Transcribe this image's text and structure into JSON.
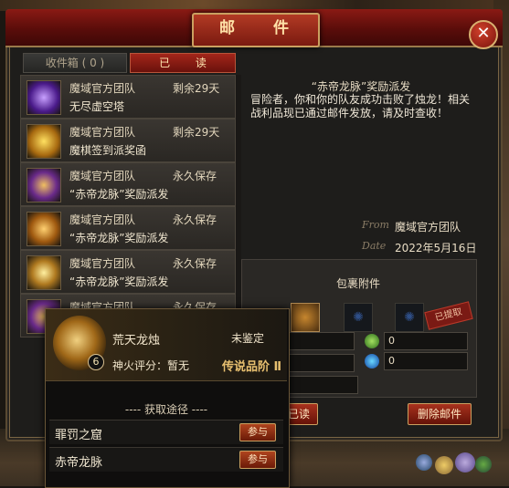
{
  "window": {
    "title": "邮 件",
    "close_label": "✕"
  },
  "tabs": [
    {
      "label": "收件箱 ( 0 )"
    },
    {
      "label": "已 读"
    }
  ],
  "mails": [
    {
      "sender": "魔域官方团队",
      "expiry": "剩余29天",
      "subject": "无尽虚空塔",
      "icon": "void-crystal-icon"
    },
    {
      "sender": "魔域官方团队",
      "expiry": "剩余29天",
      "subject": "魔棋签到派奖函",
      "icon": "gold-chest-icon"
    },
    {
      "sender": "魔域官方团队",
      "expiry": "永久保存",
      "subject": "“赤帝龙脉”奖励派发",
      "icon": "purple-star-icon"
    },
    {
      "sender": "魔域官方团队",
      "expiry": "永久保存",
      "subject": "“赤帝龙脉”奖励派发",
      "icon": "gold-rune-icon"
    },
    {
      "sender": "魔域官方团队",
      "expiry": "永久保存",
      "subject": "“赤帝龙脉”奖励派发",
      "icon": "gold-star-icon"
    },
    {
      "sender": "魔域官方团队",
      "expiry": "永久保存",
      "subject": "",
      "icon": "purple-star-icon"
    }
  ],
  "detail": {
    "title": "“赤帝龙脉”奖励派发",
    "body": "冒险者，你和你的队友成功击败了烛龙！相关战利品现已通过邮件发放，请及时查收！",
    "from_label": "From",
    "from": "魔域官方团队",
    "date_label": "Date",
    "date": "2022年5月16日"
  },
  "attachments": {
    "title": "包裹附件",
    "claimed_label": "已提取",
    "resource_1": "0",
    "resource_2": "0"
  },
  "buttons": {
    "mark_read": "已读",
    "delete": "删除邮件"
  },
  "tooltip": {
    "item_name": "荒天龙烛",
    "status": "未鉴定",
    "level": "6",
    "score": "神火评分：暂无",
    "rank": "传说品阶 Ⅱ",
    "source_heading": "---- 获取途径 ----",
    "sources": [
      {
        "name": "罪罚之窟",
        "action": "参与"
      },
      {
        "name": "赤帝龙脉",
        "action": "参与"
      }
    ]
  }
}
